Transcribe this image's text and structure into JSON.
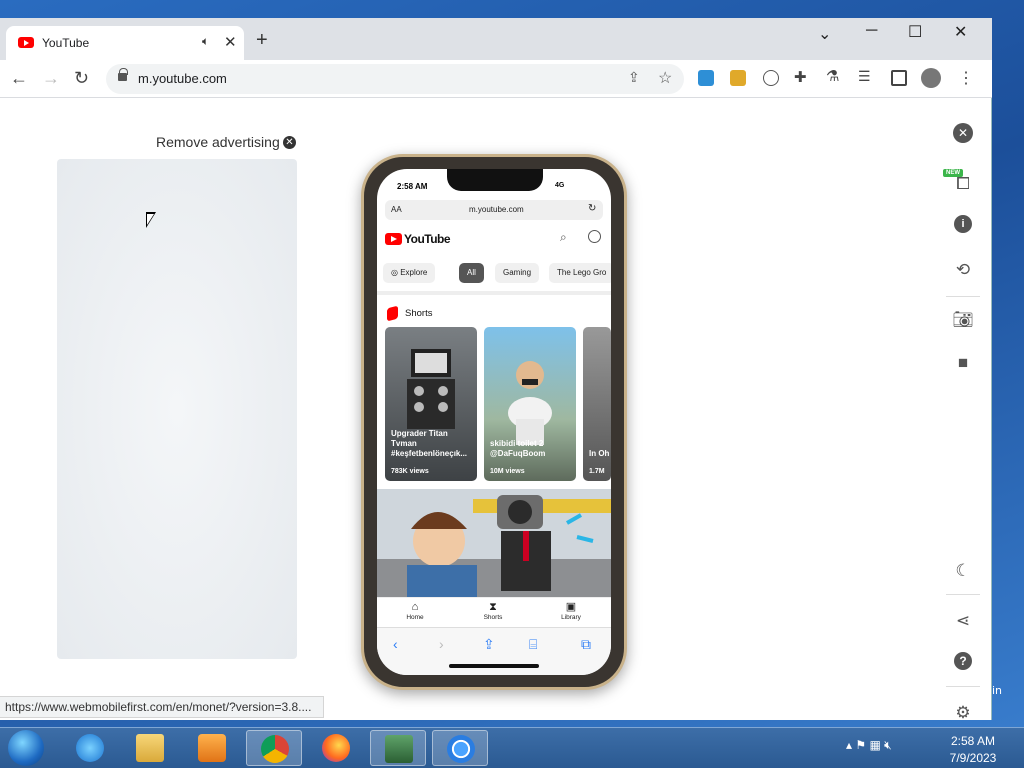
{
  "browser": {
    "tab_title": "YouTube",
    "tab_close": "✕",
    "new_tab": "+",
    "url": "m.youtube.com",
    "status_link": "https://www.webmobilefirst.com/en/monet/?version=3.8...."
  },
  "page": {
    "remove_ad": "Remove advertising",
    "remove_ad_icon": "✕"
  },
  "phone": {
    "time": "2:58 AM",
    "signal": "4G",
    "url_aa": "AA",
    "url": "m.youtube.com",
    "app_name": "YouTube",
    "chips": [
      "Explore",
      "All",
      "Gaming",
      "The Lego Gro"
    ],
    "shorts_label": "Shorts",
    "shorts": [
      {
        "caption": "Upgrader Titan Tvman #keşfetbenlöneçık...",
        "views": "783K views"
      },
      {
        "caption": "skibidi toilet 2 @DaFuqBoom",
        "views": "10M views"
      },
      {
        "caption": "In Oh",
        "views": "1.7M"
      }
    ],
    "bottom_nav": [
      "Home",
      "Shorts",
      "Library"
    ]
  },
  "right_toolbar": {
    "new_badge": "NEW"
  },
  "desktop": {
    "edge_text": "in"
  },
  "taskbar": {
    "time": "2:58 AM",
    "date": "7/9/2023"
  },
  "icons": [
    "youtube-icon",
    "speaker-icon",
    "close-icon",
    "back-icon",
    "forward-icon",
    "reload-icon",
    "lock-icon",
    "share-icon",
    "star-icon",
    "puzzle-icon",
    "profile-icon",
    "menu-icon",
    "gear-icon",
    "help-icon",
    "moon-icon",
    "camera-icon",
    "video-icon",
    "rotate-icon",
    "info-icon"
  ]
}
